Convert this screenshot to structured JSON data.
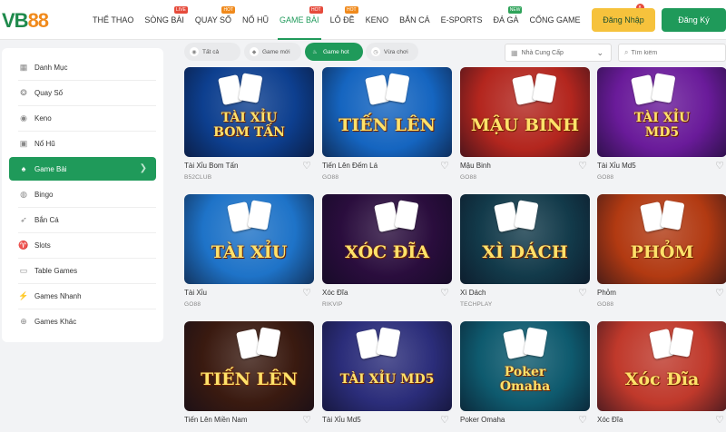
{
  "brand": {
    "logo_text_1": "VB",
    "logo_text_2": "88"
  },
  "nav": [
    {
      "label": "THỂ THAO",
      "badge": ""
    },
    {
      "label": "SÒNG BÀI",
      "badge": "LIVE",
      "badge_color": "red"
    },
    {
      "label": "QUAY SỐ",
      "badge": "HOT",
      "badge_color": "orange"
    },
    {
      "label": "NỔ HŨ",
      "badge": ""
    },
    {
      "label": "GAME BÀI",
      "badge": "HOT",
      "badge_color": "red",
      "active": true
    },
    {
      "label": "LÔ ĐỀ",
      "badge": "HOT",
      "badge_color": "orange"
    },
    {
      "label": "KENO",
      "badge": ""
    },
    {
      "label": "BẮN CÁ",
      "badge": ""
    },
    {
      "label": "E-SPORTS",
      "badge": ""
    },
    {
      "label": "ĐÁ GÀ",
      "badge": "NEW",
      "badge_color": "green"
    },
    {
      "label": "CỔNG GAME",
      "badge": ""
    },
    {
      "label": "KHUYẾN MÃI",
      "badge": "8",
      "badge_color": "dot"
    }
  ],
  "auth": {
    "login": "Đăng Nhập",
    "register": "Đăng Ký"
  },
  "sidebar": {
    "items": [
      {
        "label": "Danh Mục",
        "icon": "grid-icon"
      },
      {
        "label": "Quay Số",
        "icon": "lottery-icon"
      },
      {
        "label": "Keno",
        "icon": "keno-icon"
      },
      {
        "label": "Nổ Hũ",
        "icon": "slot-jackpot-icon"
      },
      {
        "label": "Game Bài",
        "icon": "card-game-icon",
        "active": true
      },
      {
        "label": "Bingo",
        "icon": "bingo-icon"
      },
      {
        "label": "Bắn Cá",
        "icon": "fish-icon"
      },
      {
        "label": "Slots",
        "icon": "slots-icon"
      },
      {
        "label": "Table Games",
        "icon": "table-icon"
      },
      {
        "label": "Games Nhanh",
        "icon": "fast-game-icon"
      },
      {
        "label": "Games Khác",
        "icon": "other-games-icon"
      }
    ]
  },
  "filters": {
    "chips": [
      {
        "label": "Tất cả",
        "icon": "all-icon"
      },
      {
        "label": "Game mới",
        "icon": "new-icon"
      },
      {
        "label": "Game hot",
        "icon": "fire-icon",
        "active": true
      },
      {
        "label": "Vừa chơi",
        "icon": "recent-icon"
      }
    ],
    "provider_select": "Nhà Cung Cấp",
    "search_placeholder": "Tìm kiếm"
  },
  "games": [
    {
      "name": "Tài Xỉu Bom Tấn",
      "provider": "B52CLUB",
      "art": "TÀI XỈU\nBOM TẤN",
      "bg": "#0d3f8f"
    },
    {
      "name": "Tiến Lên Đếm Lá",
      "provider": "GO88",
      "art": "TIẾN LÊN",
      "bg": "#1565c0"
    },
    {
      "name": "Mậu Binh",
      "provider": "GO88",
      "art": "MẬU BINH",
      "bg": "#b3261e"
    },
    {
      "name": "Tài Xỉu Md5",
      "provider": "GO88",
      "art": "TÀI XỈU\nMD5",
      "bg": "#6a1b9a"
    },
    {
      "name": "Tài Xỉu",
      "provider": "GO88",
      "art": "TÀI XỈU",
      "bg": "#1e73c8"
    },
    {
      "name": "Xóc Đĩa",
      "provider": "RIKVIP",
      "art": "XÓC ĐĨA",
      "bg": "#2a0d3d"
    },
    {
      "name": "Xì Dách",
      "provider": "TECHPLAY",
      "art": "XÌ DÁCH",
      "bg": "#123a4a"
    },
    {
      "name": "Phỏm",
      "provider": "GO88",
      "art": "PHỎM",
      "bg": "#b23a12"
    },
    {
      "name": "Tiến Lên Miền Nam",
      "provider": "",
      "art": "TIẾN LÊN",
      "bg": "#3a1a10"
    },
    {
      "name": "Tài Xỉu Md5",
      "provider": "",
      "art": "TÀI XỈU MD5",
      "bg": "#2b2d7a"
    },
    {
      "name": "Poker Omaha",
      "provider": "",
      "art": "Poker\nOmaha",
      "bg": "#0e5a6e"
    },
    {
      "name": "Xóc Đĩa",
      "provider": "",
      "art": "Xóc Đĩa",
      "bg": "#c0392b"
    }
  ]
}
